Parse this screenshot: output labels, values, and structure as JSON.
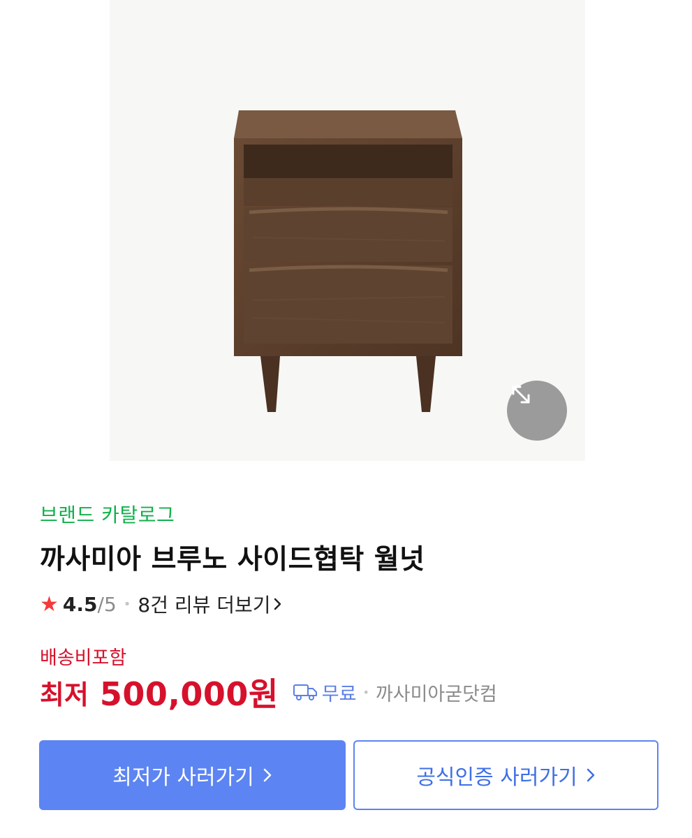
{
  "brand_link": "브랜드 카탈로그",
  "product": {
    "title": "까사미아 브루노 사이드협탁 월넛"
  },
  "rating": {
    "score": "4.5",
    "max": "/5",
    "reviews_link": "8건 리뷰 더보기"
  },
  "price": {
    "shipping_included": "배송비포함",
    "label": "최저",
    "value": "500,000원",
    "shipping_fee": "무료",
    "seller": "까사미아굳닷컴"
  },
  "buttons": {
    "lowest": "최저가 사러가기",
    "official": "공식인증 사러가기"
  },
  "colors": {
    "brand_green": "#11b04b",
    "price_red": "#d6112c",
    "accent_blue": "#5c84f2",
    "star_red": "#f5393b"
  },
  "icons": {
    "zoom": "expand-arrows-icon",
    "star": "star-icon",
    "truck": "truck-icon",
    "chevron": "chevron-right-icon"
  }
}
